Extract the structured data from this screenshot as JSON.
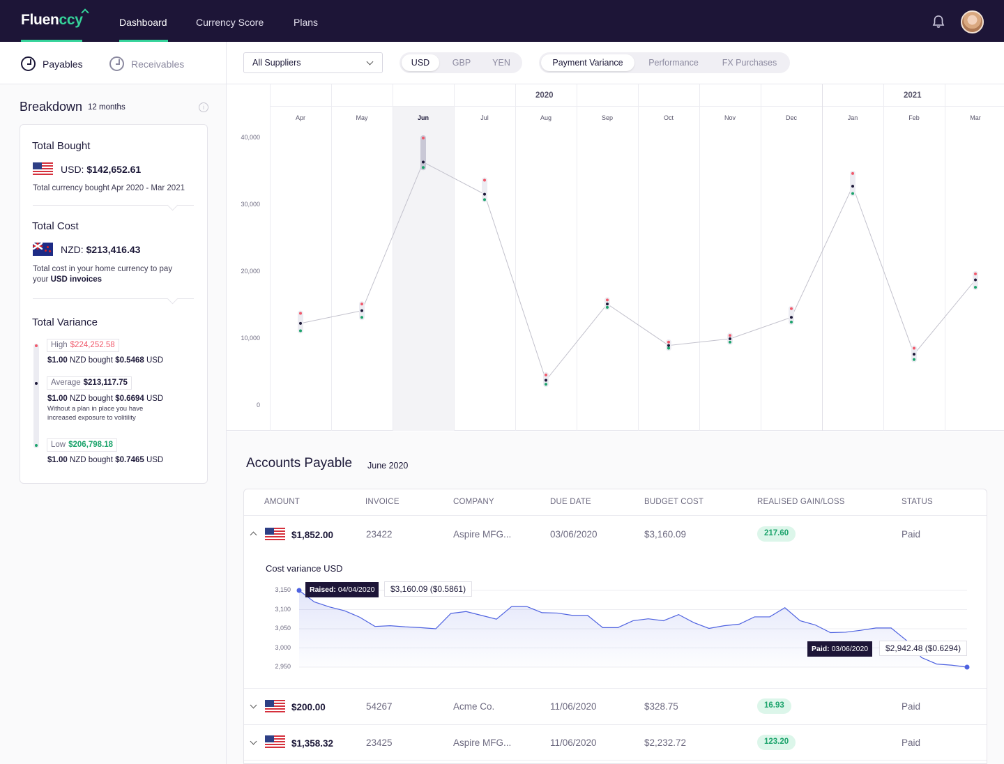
{
  "nav": {
    "logo_main": "Fluen",
    "logo_accent": "ccy",
    "items": [
      "Dashboard",
      "Currency Score",
      "Plans"
    ],
    "active": "Dashboard"
  },
  "tabs": {
    "payables": "Payables",
    "receivables": "Receivables"
  },
  "filters": {
    "supplier": "All Suppliers",
    "currencies": [
      "USD",
      "GBP",
      "YEN"
    ],
    "active_currency": "USD",
    "views": [
      "Payment Variance",
      "Performance",
      "FX Purchases"
    ],
    "active_view": "Payment Variance"
  },
  "breakdown": {
    "title": "Breakdown",
    "period": "12 months",
    "total_bought": {
      "heading": "Total Bought",
      "currency": "USD:",
      "amount": "$142,652.61",
      "note": "Total currency bought Apr 2020 - Mar 2021"
    },
    "total_cost": {
      "heading": "Total Cost",
      "currency": "NZD:",
      "amount": "$213,416.43",
      "note_1": "Total cost in your home currency to pay",
      "note_2a": "your ",
      "note_2b": "USD invoices"
    },
    "total_variance": {
      "heading": "Total Variance",
      "high_label": "High",
      "high_value": "$224,252.58",
      "high_line_a": "$1.00",
      "high_line_b": " NZD bought ",
      "high_line_c": "$0.5468",
      "high_line_d": " USD",
      "avg_label": "Average",
      "avg_value": "$213,117.75",
      "avg_line_a": "$1.00",
      "avg_line_b": " NZD bought ",
      "avg_line_c": "$0.6694",
      "avg_line_d": " USD",
      "avg_note_1": "Without a plan in place you have",
      "avg_note_2": "increased exposure to volitility",
      "low_label": "Low",
      "low_value": "$206,798.18",
      "low_line_a": "$1.00",
      "low_line_b": " NZD bought ",
      "low_line_c": "$0.7465",
      "low_line_d": " USD"
    }
  },
  "colors": {
    "brand_dark": "#1d1537",
    "accent_green": "#35d39a",
    "high_red": "#f0596b",
    "low_green": "#1ba36b",
    "line_gray": "#c2c1cc",
    "blue": "#4e62e0"
  },
  "chart_data": [
    {
      "type": "line",
      "title": "",
      "years": [
        "2020",
        "2021"
      ],
      "categories": [
        "Apr",
        "May",
        "Jun",
        "Jul",
        "Aug",
        "Sep",
        "Oct",
        "Nov",
        "Dec",
        "Jan",
        "Feb",
        "Mar"
      ],
      "highlight": "Jun",
      "yticks": [
        "40,000",
        "30,000",
        "20,000",
        "10,000",
        "0"
      ],
      "ylim": [
        0,
        40000
      ],
      "series": [
        {
          "values": [
            12300,
            14200,
            36400,
            31600,
            3800,
            15200,
            9000,
            10000,
            13200,
            32800,
            7700,
            18800
          ]
        }
      ],
      "high": [
        13800,
        15200,
        40000,
        33700,
        4600,
        15800,
        9500,
        10500,
        14500,
        34700,
        8600,
        19700
      ],
      "low": [
        11200,
        13200,
        35600,
        30800,
        3200,
        14700,
        8600,
        9500,
        12500,
        31700,
        6900,
        17700
      ],
      "grid": false,
      "legend": "none"
    },
    {
      "type": "area",
      "title": "Cost variance USD",
      "yticks": [
        "3,150",
        "3,100",
        "3,050",
        "3,000",
        "2,950"
      ],
      "ylim": [
        2950,
        3150
      ],
      "series": [
        {
          "values": [
            3150,
            3120,
            3107,
            3097,
            3080,
            3056,
            3058,
            3055,
            3053,
            3050,
            3090,
            3095,
            3085,
            3075,
            3108,
            3108,
            3092,
            3091,
            3085,
            3085,
            3053,
            3053,
            3071,
            3076,
            3071,
            3087,
            3066,
            3051,
            3058,
            3062,
            3081,
            3081,
            3105,
            3071,
            3060,
            3040,
            3041,
            3046,
            3052,
            3052,
            3020,
            2975,
            2958,
            2955,
            2950
          ]
        }
      ],
      "start_tooltip": {
        "label": "Raised:",
        "date": "04/04/2020",
        "value": "$3,160.09 ($0.5861)"
      },
      "end_tooltip": {
        "label": "Paid:",
        "date": "03/06/2020",
        "value": "$2,942.48 ($0.6294)"
      },
      "grid": true,
      "legend": "none"
    }
  ],
  "accounts_payable": {
    "title": "Accounts Payable",
    "period": "June 2020",
    "columns": [
      "AMOUNT",
      "INVOICE",
      "COMPANY",
      "DUE DATE",
      "BUDGET COST",
      "REALISED GAIN/LOSS",
      "STATUS"
    ],
    "rows": [
      {
        "amount": "$1,852.00",
        "invoice": "23422",
        "company": "Aspire MFG...",
        "due": "03/06/2020",
        "budget": "$3,160.09",
        "gain": "217.60",
        "status": "Paid"
      },
      {
        "amount": "$200.00",
        "invoice": "54267",
        "company": "Acme Co.",
        "due": "11/06/2020",
        "budget": "$328.75",
        "gain": "16.93",
        "status": "Paid"
      },
      {
        "amount": "$1,358.32",
        "invoice": "23425",
        "company": "Aspire MFG...",
        "due": "11/06/2020",
        "budget": "$2,232.72",
        "gain": "123.20",
        "status": "Paid"
      }
    ]
  }
}
